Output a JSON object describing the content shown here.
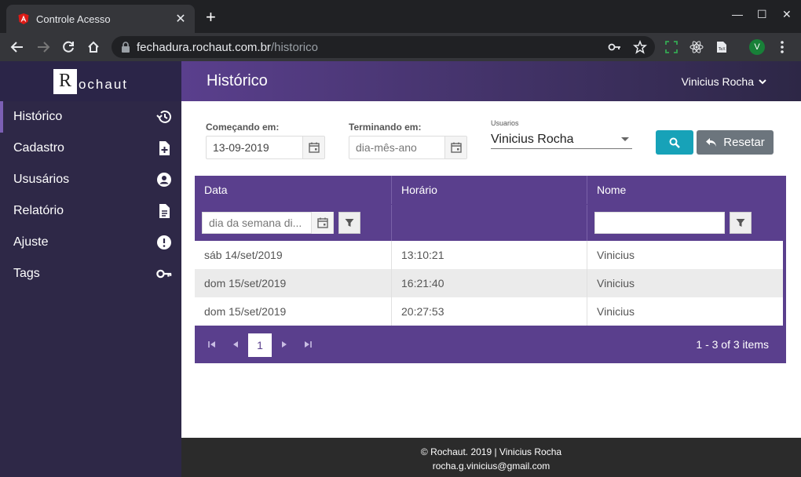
{
  "browser": {
    "tab_title": "Controle Acesso",
    "url_domain": "fechadura.rochaut.com.br",
    "url_path": "/historico",
    "profile_initial": "V"
  },
  "brand": {
    "logo_letter": "R",
    "logo_rest": "ochaut"
  },
  "sidebar": {
    "items": [
      {
        "label": "Histórico",
        "icon": "history-icon"
      },
      {
        "label": "Cadastro",
        "icon": "file-add-icon"
      },
      {
        "label": "Ususários",
        "icon": "user-circle-icon"
      },
      {
        "label": "Relatório",
        "icon": "document-icon"
      },
      {
        "label": "Ajuste",
        "icon": "alert-circle-icon"
      },
      {
        "label": "Tags",
        "icon": "key-icon"
      }
    ]
  },
  "header": {
    "title": "Histórico",
    "user": "Vinicius Rocha"
  },
  "filters": {
    "start_label": "Começando em:",
    "start_value": "13-09-2019",
    "end_label": "Terminando em:",
    "end_placeholder": "dia-mês-ano",
    "user_label": "Usuarios",
    "user_value": "Vinicius Rocha",
    "reset_label": "Resetar"
  },
  "grid": {
    "columns": [
      "Data",
      "Horário",
      "Nome"
    ],
    "date_filter_placeholder": "dia da semana di...",
    "rows": [
      {
        "data": "sáb 14/set/2019",
        "horario": "13:10:21",
        "nome": "Vinicius"
      },
      {
        "data": "dom 15/set/2019",
        "horario": "16:21:40",
        "nome": "Vinicius"
      },
      {
        "data": "dom 15/set/2019",
        "horario": "20:27:53",
        "nome": "Vinicius"
      }
    ],
    "current_page": "1",
    "pager_info": "1 - 3 of 3 items"
  },
  "footer": {
    "line1": "© Rochaut. 2019 | Vinicius Rocha",
    "line2": "rocha.g.vinicius@gmail.com"
  },
  "colors": {
    "primary": "#5a3f8d",
    "sidebar": "#2e2847",
    "search": "#17a2b8",
    "reset": "#6c757d"
  }
}
